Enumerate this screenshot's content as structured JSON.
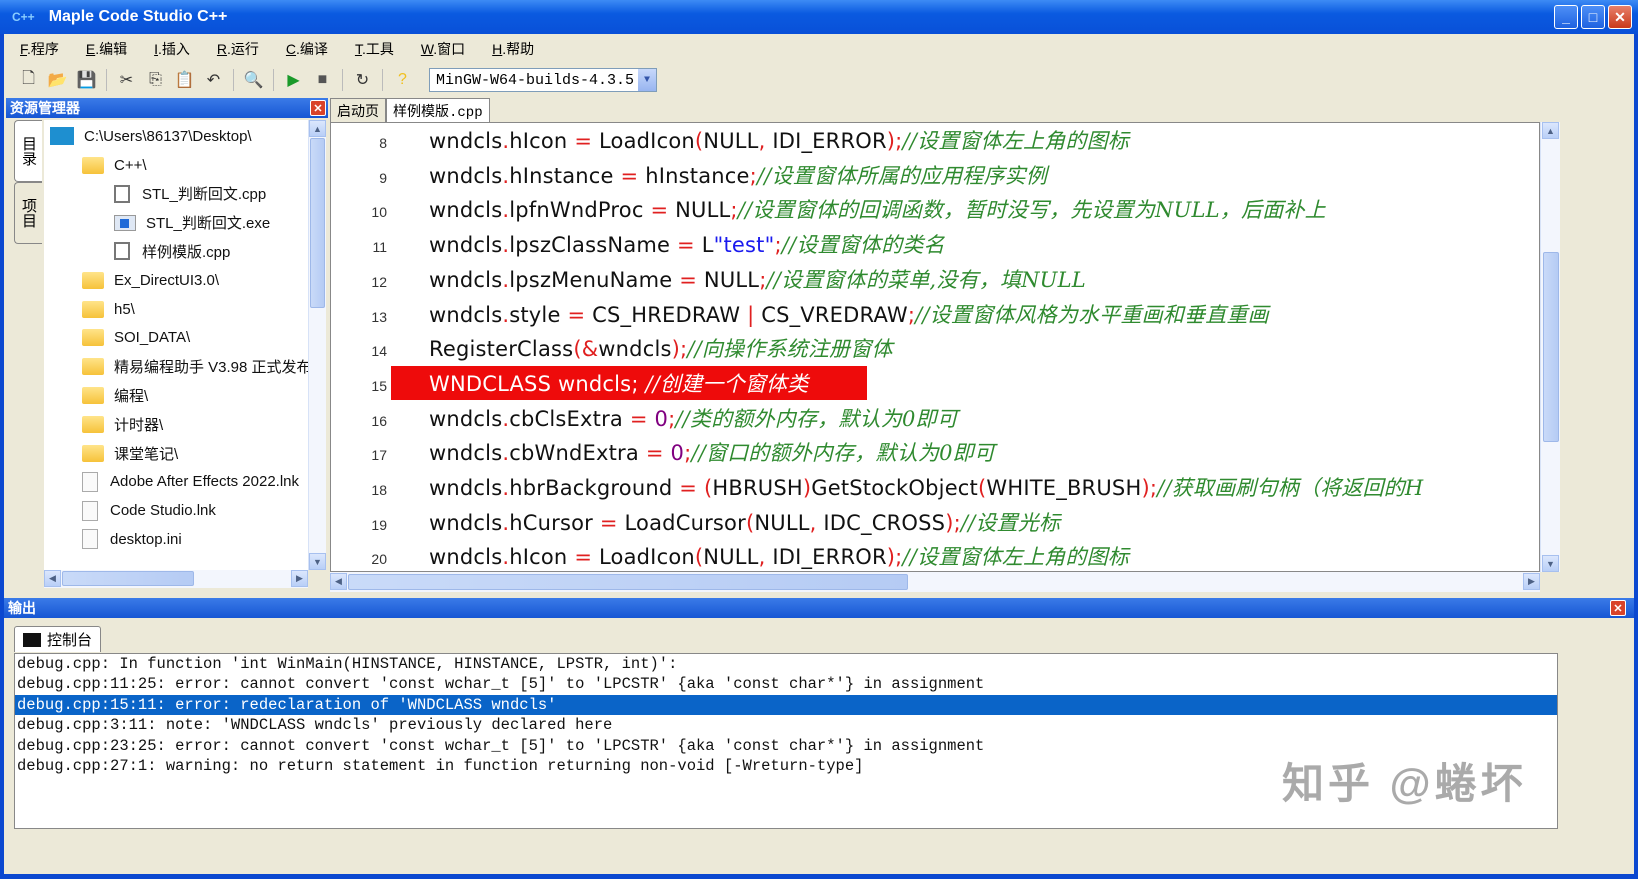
{
  "window": {
    "title": "Maple Code Studio C++",
    "app_icon": "C++"
  },
  "menu": [
    {
      "key": "F",
      "label": ".程序"
    },
    {
      "key": "E",
      "label": ".编辑"
    },
    {
      "key": "I",
      "label": ".插入"
    },
    {
      "key": "R",
      "label": ".运行"
    },
    {
      "key": "C",
      "label": ".编译"
    },
    {
      "key": "T",
      "label": ".工具"
    },
    {
      "key": "W",
      "label": ".窗口"
    },
    {
      "key": "H",
      "label": ".帮助"
    }
  ],
  "toolbar": {
    "compiler": "MinGW-W64-builds-4.3.5"
  },
  "explorer": {
    "title": "资源管理器",
    "vtabs": [
      "目录",
      "项目"
    ],
    "root": "C:\\Users\\86137\\Desktop\\",
    "items": [
      {
        "label": "C++\\",
        "type": "folder"
      },
      {
        "label": "STL_判断回文.cpp",
        "type": "cpp"
      },
      {
        "label": "STL_判断回文.exe",
        "type": "exe"
      },
      {
        "label": "样例模版.cpp",
        "type": "cpp"
      },
      {
        "label": "Ex_DirectUI3.0\\",
        "type": "folder"
      },
      {
        "label": "h5\\",
        "type": "folder"
      },
      {
        "label": "SOI_DATA\\",
        "type": "folder"
      },
      {
        "label": "精易编程助手 V3.98 正式发布",
        "type": "folder"
      },
      {
        "label": "编程\\",
        "type": "folder"
      },
      {
        "label": "计时器\\",
        "type": "folder"
      },
      {
        "label": "课堂笔记\\",
        "type": "folder"
      },
      {
        "label": "Adobe After Effects 2022.lnk",
        "type": "file"
      },
      {
        "label": "Code Studio.lnk",
        "type": "file"
      },
      {
        "label": "desktop.ini",
        "type": "file"
      }
    ]
  },
  "editor": {
    "tabs": [
      "启动页",
      "样例模版.cpp"
    ],
    "active_tab": 1,
    "error_line": 15,
    "lines": [
      {
        "n": "8",
        "t": [
          [
            "id",
            "wndcls"
          ],
          [
            "op",
            "."
          ],
          [
            "id",
            "hIcon "
          ],
          [
            "op",
            "="
          ],
          [
            "id",
            " LoadIcon"
          ],
          [
            "op",
            "("
          ],
          [
            "id",
            "NULL"
          ],
          [
            "op",
            ","
          ],
          [
            "id",
            " IDI_ERROR"
          ],
          [
            "op",
            ");"
          ],
          [
            "cm",
            "//设置窗体左上角的图标"
          ]
        ]
      },
      {
        "n": "9",
        "t": [
          [
            "id",
            "wndcls"
          ],
          [
            "op",
            "."
          ],
          [
            "id",
            "hInstance "
          ],
          [
            "op",
            "="
          ],
          [
            "id",
            " hInstance"
          ],
          [
            "op",
            ";"
          ],
          [
            "cm",
            "//设置窗体所属的应用程序实例"
          ]
        ]
      },
      {
        "n": "10",
        "t": [
          [
            "id",
            "wndcls"
          ],
          [
            "op",
            "."
          ],
          [
            "id",
            "lpfnWndProc "
          ],
          [
            "op",
            "="
          ],
          [
            "id",
            " NULL"
          ],
          [
            "op",
            ";"
          ],
          [
            "cm",
            "//设置窗体的回调函数，暂时没写，先设置为NULL，后面补上"
          ]
        ]
      },
      {
        "n": "11",
        "t": [
          [
            "id",
            "wndcls"
          ],
          [
            "op",
            "."
          ],
          [
            "id",
            "lpszClassName "
          ],
          [
            "op",
            "="
          ],
          [
            "id",
            " L"
          ],
          [
            "str",
            "\"test\""
          ],
          [
            "op",
            ";"
          ],
          [
            "cm",
            "//设置窗体的类名"
          ]
        ]
      },
      {
        "n": "12",
        "t": [
          [
            "id",
            "wndcls"
          ],
          [
            "op",
            "."
          ],
          [
            "id",
            "lpszMenuName "
          ],
          [
            "op",
            "="
          ],
          [
            "id",
            " NULL"
          ],
          [
            "op",
            ";"
          ],
          [
            "cm",
            "//设置窗体的菜单,没有，填NULL"
          ]
        ]
      },
      {
        "n": "13",
        "t": [
          [
            "id",
            "wndcls"
          ],
          [
            "op",
            "."
          ],
          [
            "id",
            "style "
          ],
          [
            "op",
            "="
          ],
          [
            "id",
            " CS_HREDRAW "
          ],
          [
            "op",
            "|"
          ],
          [
            "id",
            " CS_VREDRAW"
          ],
          [
            "op",
            ";"
          ],
          [
            "cm",
            "//设置窗体风格为水平重画和垂直重画"
          ]
        ]
      },
      {
        "n": "14",
        "t": [
          [
            "id",
            "RegisterClass"
          ],
          [
            "op",
            "(&"
          ],
          [
            "id",
            "wndcls"
          ],
          [
            "op",
            ");"
          ],
          [
            "cm",
            "//向操作系统注册窗体"
          ]
        ]
      },
      {
        "n": "15",
        "t": [
          [
            "id",
            "WNDCLASS wndcls; "
          ],
          [
            "cm",
            "//创建一个窗体类"
          ]
        ]
      },
      {
        "n": "16",
        "t": [
          [
            "id",
            "wndcls"
          ],
          [
            "op",
            "."
          ],
          [
            "id",
            "cbClsExtra "
          ],
          [
            "op",
            "="
          ],
          [
            "id",
            " "
          ],
          [
            "num",
            "0"
          ],
          [
            "op",
            ";"
          ],
          [
            "cm",
            "//类的额外内存，默认为0即可"
          ]
        ]
      },
      {
        "n": "17",
        "t": [
          [
            "id",
            "wndcls"
          ],
          [
            "op",
            "."
          ],
          [
            "id",
            "cbWndExtra "
          ],
          [
            "op",
            "="
          ],
          [
            "id",
            " "
          ],
          [
            "num",
            "0"
          ],
          [
            "op",
            ";"
          ],
          [
            "cm",
            "//窗口的额外内存，默认为0即可"
          ]
        ]
      },
      {
        "n": "18",
        "t": [
          [
            "id",
            "wndcls"
          ],
          [
            "op",
            "."
          ],
          [
            "id",
            "hbrBackground "
          ],
          [
            "op",
            "="
          ],
          [
            "id",
            " "
          ],
          [
            "op",
            "("
          ],
          [
            "id",
            "HBRUSH"
          ],
          [
            "op",
            ")"
          ],
          [
            "id",
            "GetStockObject"
          ],
          [
            "op",
            "("
          ],
          [
            "id",
            "WHITE_BRUSH"
          ],
          [
            "op",
            ");"
          ],
          [
            "cm",
            "//获取画刷句柄（将返回的H"
          ]
        ]
      },
      {
        "n": "19",
        "t": [
          [
            "id",
            "wndcls"
          ],
          [
            "op",
            "."
          ],
          [
            "id",
            "hCursor "
          ],
          [
            "op",
            "="
          ],
          [
            "id",
            " LoadCursor"
          ],
          [
            "op",
            "("
          ],
          [
            "id",
            "NULL"
          ],
          [
            "op",
            ","
          ],
          [
            "id",
            " IDC_CROSS"
          ],
          [
            "op",
            ");"
          ],
          [
            "cm",
            "//设置光标"
          ]
        ]
      },
      {
        "n": "20",
        "t": [
          [
            "id",
            "wndcls"
          ],
          [
            "op",
            "."
          ],
          [
            "id",
            "hIcon "
          ],
          [
            "op",
            "="
          ],
          [
            "id",
            " LoadIcon"
          ],
          [
            "op",
            "("
          ],
          [
            "id",
            "NULL"
          ],
          [
            "op",
            ","
          ],
          [
            "id",
            " IDI_ERROR"
          ],
          [
            "op",
            ");"
          ],
          [
            "cm",
            "//设置窗体左上角的图标"
          ]
        ]
      }
    ]
  },
  "output": {
    "title": "输出",
    "tab": "控制台",
    "selected": 2,
    "lines": [
      "debug.cpp: In function 'int WinMain(HINSTANCE, HINSTANCE, LPSTR, int)':",
      "debug.cpp:11:25: error: cannot convert 'const wchar_t [5]' to 'LPCSTR' {aka 'const char*'} in assignment",
      "debug.cpp:15:11: error: redeclaration of 'WNDCLASS wndcls'",
      "debug.cpp:3:11: note: 'WNDCLASS wndcls' previously declared here",
      "debug.cpp:23:25: error: cannot convert 'const wchar_t [5]' to 'LPCSTR' {aka 'const char*'} in assignment",
      "debug.cpp:27:1: warning: no return statement in function returning non-void [-Wreturn-type]"
    ]
  },
  "watermark": "知乎 @蜷坏"
}
